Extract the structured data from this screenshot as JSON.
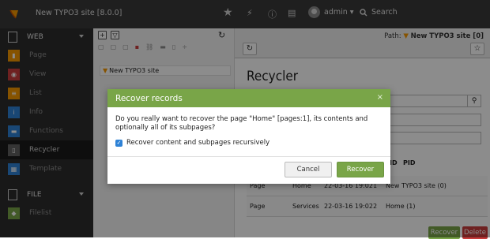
{
  "topbar": {
    "site_name": "New TYPO3 site [8.0.0]",
    "user_name": "admin ▾",
    "search_label": "Search"
  },
  "modules": {
    "web_group": "WEB",
    "file_group": "FILE",
    "items": [
      {
        "label": "Page",
        "color": "#f49700",
        "icon": "page-icon"
      },
      {
        "label": "View",
        "color": "#c83c3c",
        "icon": "view-icon"
      },
      {
        "label": "List",
        "color": "#f49700",
        "icon": "list-icon"
      },
      {
        "label": "Info",
        "color": "#2e82d6",
        "icon": "info-icon"
      },
      {
        "label": "Functions",
        "color": "#2e82d6",
        "icon": "functions-icon"
      },
      {
        "label": "Recycler",
        "color": "#616161",
        "icon": "trash-icon"
      },
      {
        "label": "Template",
        "color": "#2e82d6",
        "icon": "template-icon"
      }
    ],
    "file_items": [
      {
        "label": "Filelist",
        "color": "#79a548",
        "icon": "filelist-icon"
      }
    ]
  },
  "tree": {
    "root_label": "New TYPO3 site"
  },
  "content": {
    "path_label": "Path:",
    "path_value": "New TYPO3 site [0]",
    "title": "Recycler",
    "columns": {
      "id": "ID",
      "pid": "PID"
    },
    "rows": [
      {
        "type": "Page",
        "title": "Home",
        "date": "22-03-16 19:02",
        "id": "1",
        "pid": "New TYPO3 site (0)"
      },
      {
        "type": "Page",
        "title": "Services",
        "date": "22-03-16 19:02",
        "id": "2",
        "pid": "Home (1)"
      }
    ],
    "recover_label": "Recover",
    "delete_label": "Delete"
  },
  "modal": {
    "title": "Recover records",
    "close_symbol": "×",
    "message": "Do you really want to recover the page \"Home\" [pages:1], its contents and optionally all of its subpages?",
    "checkbox_label": "Recover content and subpages recursively",
    "cancel_label": "Cancel",
    "recover_label": "Recover"
  }
}
